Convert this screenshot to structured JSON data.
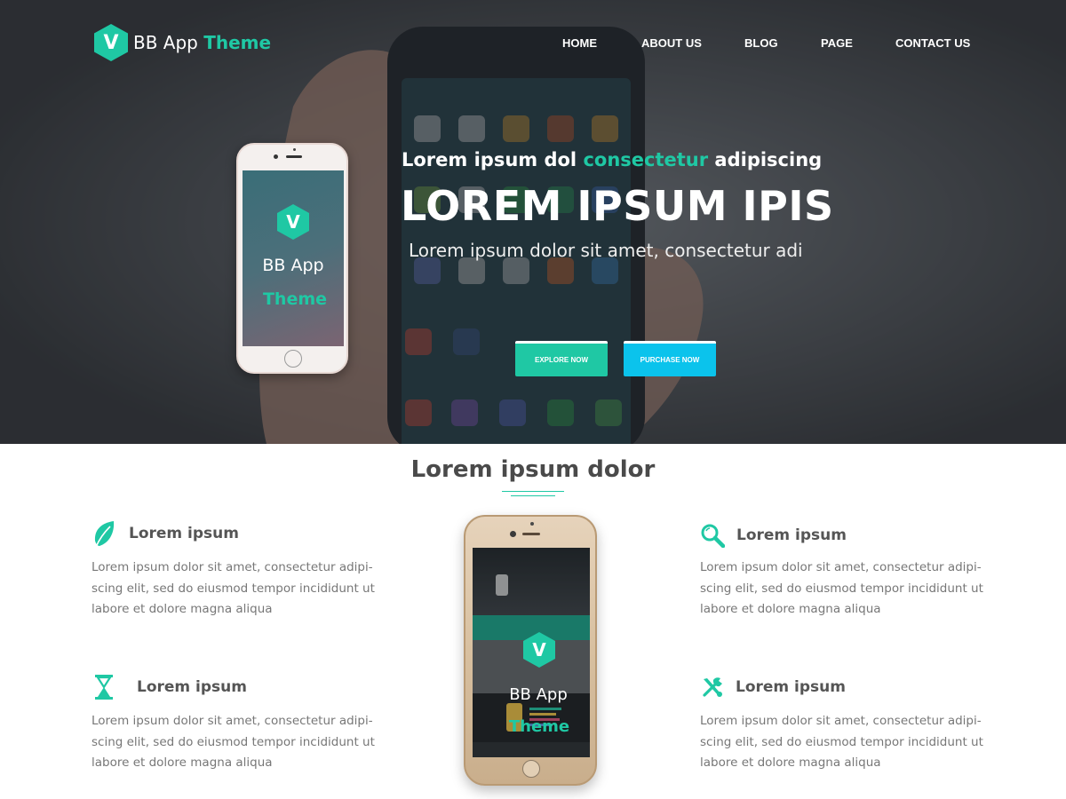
{
  "brand": {
    "logo_letter": "V",
    "name_primary": "BB App",
    "name_accent": "Theme",
    "accent_color": "#1fc8a4",
    "cyan_color": "#0bc3ec"
  },
  "nav": {
    "items": [
      "HOME",
      "ABOUT US",
      "BLOG",
      "PAGE",
      "CONTACT US"
    ]
  },
  "hero": {
    "tagline_part1": "Lorem ipsum dol",
    "tagline_accent": "consectetur",
    "tagline_part2": "adipiscing",
    "headline": "LOREM IPSUM IPIS",
    "subheadline": "Lorem ipsum dolor sit amet, consectetur adi",
    "explore_button": "EXPLORE NOW",
    "purchase_button": "PURCHASE NOW",
    "phone_logo_letter": "V",
    "phone_line1": "BB App",
    "phone_line2": "Theme"
  },
  "features": {
    "section_title": "Lorem ipsum dolor",
    "items": [
      {
        "icon": "leaf-icon",
        "title": "Lorem ipsum",
        "text": "Lorem ipsum dolor sit amet, consectetur adipi- scing elit, sed do eiusmod tempor incididunt ut labore et dolore magna aliqua"
      },
      {
        "icon": "hourglass-icon",
        "title": "Lorem ipsum",
        "text": "Lorem ipsum dolor sit amet, consectetur adipi- scing elit, sed do eiusmod tempor incididunt ut labore et dolore magna aliqua"
      },
      {
        "icon": "magnifier-icon",
        "title": "Lorem ipsum",
        "text": "Lorem ipsum dolor sit amet, consectetur adipi- scing elit, sed do eiusmod tempor incididunt ut labore et dolore magna aliqua"
      },
      {
        "icon": "tools-icon",
        "title": "Lorem ipsum",
        "text": "Lorem ipsum dolor sit amet, consectetur adipi- scing elit, sed do eiusmod tempor incididunt ut labore et dolore magna aliqua"
      }
    ],
    "phone_logo_letter": "V",
    "phone_line1": "BB App",
    "phone_line2": "Theme"
  }
}
